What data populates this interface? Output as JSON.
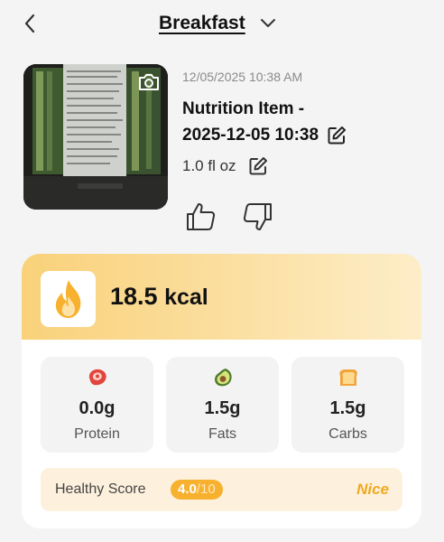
{
  "header": {
    "title": "Breakfast"
  },
  "item": {
    "timestamp": "12/05/2025 10:38 AM",
    "title_line1": "Nutrition Item -",
    "title_line2": "2025-12-05 10:38",
    "serving": "1.0 fl oz"
  },
  "energy": {
    "value": "18.5",
    "unit": "kcal"
  },
  "macros": [
    {
      "value": "0.0g",
      "label": "Protein",
      "icon": "steak-icon"
    },
    {
      "value": "1.5g",
      "label": "Fats",
      "icon": "avocado-icon"
    },
    {
      "value": "1.5g",
      "label": "Carbs",
      "icon": "bread-icon"
    }
  ],
  "health": {
    "label": "Healthy Score",
    "score": "4.0",
    "max": "/10",
    "rating": "Nice"
  },
  "colors": {
    "accent": "#f7b12e",
    "nice": "#f0a91f",
    "gradient_start": "#f9d17a"
  }
}
